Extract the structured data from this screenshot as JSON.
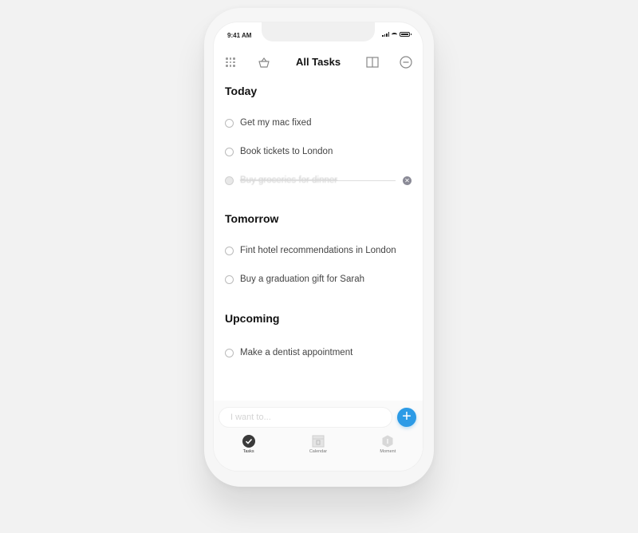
{
  "status_bar": {
    "time": "9:41 AM"
  },
  "header": {
    "title": "All Tasks",
    "icons": [
      "grid-menu-icon",
      "basket-icon",
      "book-icon",
      "minus-circle-icon"
    ]
  },
  "sections": [
    {
      "title": "Today",
      "tasks": [
        {
          "label": "Get my mac fixed",
          "done": false
        },
        {
          "label": "Book tickets to London",
          "done": false
        },
        {
          "label": "Buy groceries for dinner",
          "done": true
        }
      ]
    },
    {
      "title": "Tomorrow",
      "tasks": [
        {
          "label": "Fint hotel recommendations in London",
          "done": false
        },
        {
          "label": "Buy a graduation gift for Sarah",
          "done": false
        }
      ]
    },
    {
      "title": "Upcoming",
      "tasks": [
        {
          "label": "Make a dentist appointment",
          "done": false
        }
      ]
    }
  ],
  "composer": {
    "placeholder": "I want to...",
    "value": "",
    "add_icon": "+"
  },
  "tabbar": {
    "tabs": [
      {
        "label": "Tasks",
        "icon": "check-circle-icon",
        "active": true
      },
      {
        "label": "Calendar",
        "icon": "calendar-icon",
        "active": false
      },
      {
        "label": "Moment",
        "icon": "hexagon-icon",
        "active": false
      }
    ]
  },
  "colors": {
    "accent": "#2d9be6",
    "text": "#111111",
    "muted": "#bbbbbb"
  }
}
